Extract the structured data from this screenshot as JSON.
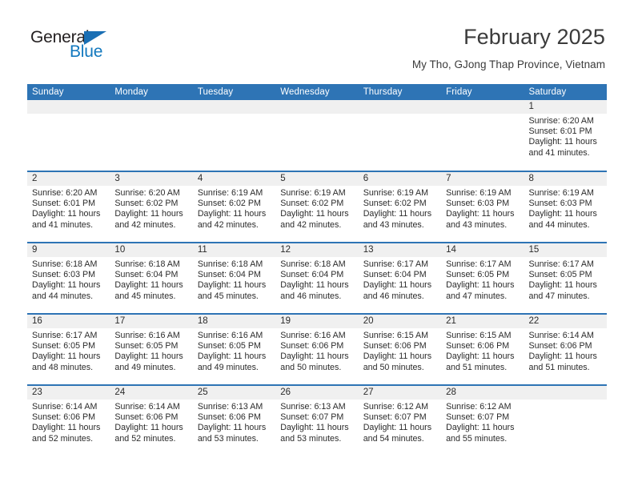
{
  "brand": {
    "name_part1": "General",
    "name_part2": "Blue",
    "flag_color": "#1a6fb4",
    "text_color": "#1278be"
  },
  "header": {
    "title": "February 2025",
    "subtitle": "My Tho, GJong Thap Province, Vietnam"
  },
  "theme": {
    "header_blue": "#2e74b5",
    "band_gray": "#f0f0f0",
    "text": "#2b2b2b"
  },
  "calendar": {
    "weekday_headers": [
      "Sunday",
      "Monday",
      "Tuesday",
      "Wednesday",
      "Thursday",
      "Friday",
      "Saturday"
    ],
    "weeks": [
      [
        {
          "day": "",
          "sunrise": "",
          "sunset": "",
          "daylight_line1": "",
          "daylight_line2": ""
        },
        {
          "day": "",
          "sunrise": "",
          "sunset": "",
          "daylight_line1": "",
          "daylight_line2": ""
        },
        {
          "day": "",
          "sunrise": "",
          "sunset": "",
          "daylight_line1": "",
          "daylight_line2": ""
        },
        {
          "day": "",
          "sunrise": "",
          "sunset": "",
          "daylight_line1": "",
          "daylight_line2": ""
        },
        {
          "day": "",
          "sunrise": "",
          "sunset": "",
          "daylight_line1": "",
          "daylight_line2": ""
        },
        {
          "day": "",
          "sunrise": "",
          "sunset": "",
          "daylight_line1": "",
          "daylight_line2": ""
        },
        {
          "day": "1",
          "sunrise": "Sunrise: 6:20 AM",
          "sunset": "Sunset: 6:01 PM",
          "daylight_line1": "Daylight: 11 hours",
          "daylight_line2": "and 41 minutes."
        }
      ],
      [
        {
          "day": "2",
          "sunrise": "Sunrise: 6:20 AM",
          "sunset": "Sunset: 6:01 PM",
          "daylight_line1": "Daylight: 11 hours",
          "daylight_line2": "and 41 minutes."
        },
        {
          "day": "3",
          "sunrise": "Sunrise: 6:20 AM",
          "sunset": "Sunset: 6:02 PM",
          "daylight_line1": "Daylight: 11 hours",
          "daylight_line2": "and 42 minutes."
        },
        {
          "day": "4",
          "sunrise": "Sunrise: 6:19 AM",
          "sunset": "Sunset: 6:02 PM",
          "daylight_line1": "Daylight: 11 hours",
          "daylight_line2": "and 42 minutes."
        },
        {
          "day": "5",
          "sunrise": "Sunrise: 6:19 AM",
          "sunset": "Sunset: 6:02 PM",
          "daylight_line1": "Daylight: 11 hours",
          "daylight_line2": "and 42 minutes."
        },
        {
          "day": "6",
          "sunrise": "Sunrise: 6:19 AM",
          "sunset": "Sunset: 6:02 PM",
          "daylight_line1": "Daylight: 11 hours",
          "daylight_line2": "and 43 minutes."
        },
        {
          "day": "7",
          "sunrise": "Sunrise: 6:19 AM",
          "sunset": "Sunset: 6:03 PM",
          "daylight_line1": "Daylight: 11 hours",
          "daylight_line2": "and 43 minutes."
        },
        {
          "day": "8",
          "sunrise": "Sunrise: 6:19 AM",
          "sunset": "Sunset: 6:03 PM",
          "daylight_line1": "Daylight: 11 hours",
          "daylight_line2": "and 44 minutes."
        }
      ],
      [
        {
          "day": "9",
          "sunrise": "Sunrise: 6:18 AM",
          "sunset": "Sunset: 6:03 PM",
          "daylight_line1": "Daylight: 11 hours",
          "daylight_line2": "and 44 minutes."
        },
        {
          "day": "10",
          "sunrise": "Sunrise: 6:18 AM",
          "sunset": "Sunset: 6:04 PM",
          "daylight_line1": "Daylight: 11 hours",
          "daylight_line2": "and 45 minutes."
        },
        {
          "day": "11",
          "sunrise": "Sunrise: 6:18 AM",
          "sunset": "Sunset: 6:04 PM",
          "daylight_line1": "Daylight: 11 hours",
          "daylight_line2": "and 45 minutes."
        },
        {
          "day": "12",
          "sunrise": "Sunrise: 6:18 AM",
          "sunset": "Sunset: 6:04 PM",
          "daylight_line1": "Daylight: 11 hours",
          "daylight_line2": "and 46 minutes."
        },
        {
          "day": "13",
          "sunrise": "Sunrise: 6:17 AM",
          "sunset": "Sunset: 6:04 PM",
          "daylight_line1": "Daylight: 11 hours",
          "daylight_line2": "and 46 minutes."
        },
        {
          "day": "14",
          "sunrise": "Sunrise: 6:17 AM",
          "sunset": "Sunset: 6:05 PM",
          "daylight_line1": "Daylight: 11 hours",
          "daylight_line2": "and 47 minutes."
        },
        {
          "day": "15",
          "sunrise": "Sunrise: 6:17 AM",
          "sunset": "Sunset: 6:05 PM",
          "daylight_line1": "Daylight: 11 hours",
          "daylight_line2": "and 47 minutes."
        }
      ],
      [
        {
          "day": "16",
          "sunrise": "Sunrise: 6:17 AM",
          "sunset": "Sunset: 6:05 PM",
          "daylight_line1": "Daylight: 11 hours",
          "daylight_line2": "and 48 minutes."
        },
        {
          "day": "17",
          "sunrise": "Sunrise: 6:16 AM",
          "sunset": "Sunset: 6:05 PM",
          "daylight_line1": "Daylight: 11 hours",
          "daylight_line2": "and 49 minutes."
        },
        {
          "day": "18",
          "sunrise": "Sunrise: 6:16 AM",
          "sunset": "Sunset: 6:05 PM",
          "daylight_line1": "Daylight: 11 hours",
          "daylight_line2": "and 49 minutes."
        },
        {
          "day": "19",
          "sunrise": "Sunrise: 6:16 AM",
          "sunset": "Sunset: 6:06 PM",
          "daylight_line1": "Daylight: 11 hours",
          "daylight_line2": "and 50 minutes."
        },
        {
          "day": "20",
          "sunrise": "Sunrise: 6:15 AM",
          "sunset": "Sunset: 6:06 PM",
          "daylight_line1": "Daylight: 11 hours",
          "daylight_line2": "and 50 minutes."
        },
        {
          "day": "21",
          "sunrise": "Sunrise: 6:15 AM",
          "sunset": "Sunset: 6:06 PM",
          "daylight_line1": "Daylight: 11 hours",
          "daylight_line2": "and 51 minutes."
        },
        {
          "day": "22",
          "sunrise": "Sunrise: 6:14 AM",
          "sunset": "Sunset: 6:06 PM",
          "daylight_line1": "Daylight: 11 hours",
          "daylight_line2": "and 51 minutes."
        }
      ],
      [
        {
          "day": "23",
          "sunrise": "Sunrise: 6:14 AM",
          "sunset": "Sunset: 6:06 PM",
          "daylight_line1": "Daylight: 11 hours",
          "daylight_line2": "and 52 minutes."
        },
        {
          "day": "24",
          "sunrise": "Sunrise: 6:14 AM",
          "sunset": "Sunset: 6:06 PM",
          "daylight_line1": "Daylight: 11 hours",
          "daylight_line2": "and 52 minutes."
        },
        {
          "day": "25",
          "sunrise": "Sunrise: 6:13 AM",
          "sunset": "Sunset: 6:06 PM",
          "daylight_line1": "Daylight: 11 hours",
          "daylight_line2": "and 53 minutes."
        },
        {
          "day": "26",
          "sunrise": "Sunrise: 6:13 AM",
          "sunset": "Sunset: 6:07 PM",
          "daylight_line1": "Daylight: 11 hours",
          "daylight_line2": "and 53 minutes."
        },
        {
          "day": "27",
          "sunrise": "Sunrise: 6:12 AM",
          "sunset": "Sunset: 6:07 PM",
          "daylight_line1": "Daylight: 11 hours",
          "daylight_line2": "and 54 minutes."
        },
        {
          "day": "28",
          "sunrise": "Sunrise: 6:12 AM",
          "sunset": "Sunset: 6:07 PM",
          "daylight_line1": "Daylight: 11 hours",
          "daylight_line2": "and 55 minutes."
        },
        {
          "day": "",
          "sunrise": "",
          "sunset": "",
          "daylight_line1": "",
          "daylight_line2": ""
        }
      ]
    ]
  }
}
